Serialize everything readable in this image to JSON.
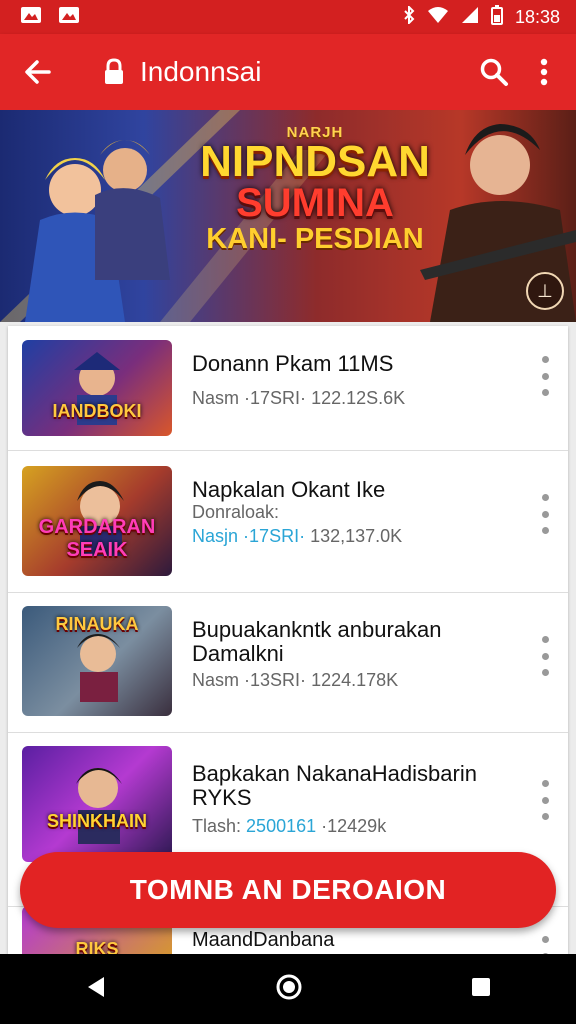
{
  "status_bar": {
    "time": "18:38",
    "left_icons": [
      "gallery-icon",
      "gallery-icon"
    ],
    "right_icons": [
      "bluetooth-icon",
      "wifi-icon",
      "signal-icon",
      "battery-icon"
    ]
  },
  "app_bar": {
    "title": "Indonnsai",
    "back_icon": "back-arrow-icon",
    "lock_icon": "lock-icon",
    "search_icon": "search-icon",
    "more_icon": "more-vertical-icon"
  },
  "banner": {
    "line1": "NARJH",
    "line2": "NIPNDSAN",
    "line3": "SUMINA",
    "line4": "KANI- PESDIAN"
  },
  "list": {
    "items": [
      {
        "thumb_text": "IANDBOKI",
        "title": "Donann Pkam 11MS",
        "subtitle": "",
        "meta_prefix": "Nasm",
        "meta_value": "·17SRI·",
        "meta_size": "122.12S.6K",
        "meta_highlight": false
      },
      {
        "thumb_text": "GARDARAN SEAIK",
        "title": "Napkalan Okant Ike",
        "subtitle": "Donraloak:",
        "meta_prefix": "Nasjn",
        "meta_value": "·17SRI·",
        "meta_size": "132,137.0K",
        "meta_highlight": true
      },
      {
        "thumb_text": "RINAUKA",
        "title": "Bupuakankntk anburakan",
        "subtitle": "Damalkni",
        "meta_prefix": "Nasm",
        "meta_value": "·13SRI·",
        "meta_size": "1224.178K",
        "meta_highlight": false
      },
      {
        "thumb_text": "SHINKHAIN",
        "title": "Bapkakan NakanaHadisbarin",
        "subtitle": "RYKS",
        "meta_prefix": "Tlash:",
        "meta_value": "2500161",
        "meta_size": "·12429k",
        "meta_highlight": true
      },
      {
        "thumb_text": "RIKS",
        "title": "MaandDanbana",
        "subtitle": "",
        "meta_prefix": "",
        "meta_value": "",
        "meta_size": "",
        "meta_highlight": false
      }
    ]
  },
  "cta": {
    "label": "TOMNB AN DEROAION"
  },
  "nav_bar": {
    "back_icon": "nav-back-icon",
    "home_icon": "nav-home-icon",
    "recents_icon": "nav-recents-icon"
  },
  "colors": {
    "primary": "#e12626",
    "status": "#d32020",
    "nav": "#000000",
    "meta_highlight": "#2aa5d6"
  }
}
